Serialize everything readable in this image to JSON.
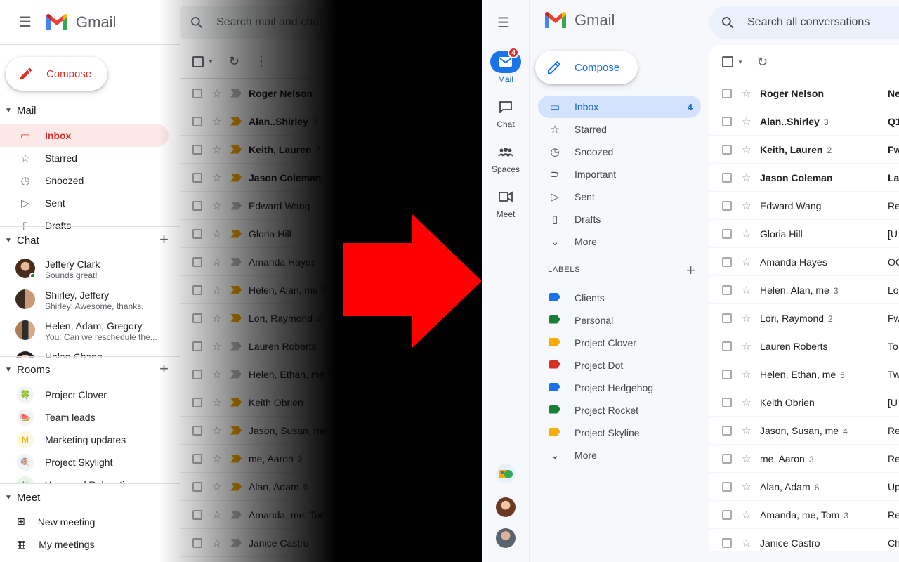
{
  "old": {
    "app_name": "Gmail",
    "compose": "Compose",
    "search_placeholder": "Search mail and chat",
    "mail_header": "Mail",
    "mail_items": [
      {
        "label": "Inbox",
        "icon": "inbox-icon",
        "active": true
      },
      {
        "label": "Starred",
        "icon": "star-icon"
      },
      {
        "label": "Snoozed",
        "icon": "clock-icon"
      },
      {
        "label": "Sent",
        "icon": "send-icon"
      },
      {
        "label": "Drafts",
        "icon": "draft-icon"
      }
    ],
    "chat_header": "Chat",
    "chats": [
      {
        "name": "Jeffery Clark",
        "preview": "Sounds great!"
      },
      {
        "name": "Shirley, Jeffery",
        "preview": "Shirley: Awesome, thanks."
      },
      {
        "name": "Helen, Adam, Gregory",
        "preview": "You: Can we reschedule the..."
      },
      {
        "name": "Helen Chang",
        "preview": ""
      }
    ],
    "rooms_header": "Rooms",
    "rooms": [
      {
        "label": "Project Clover",
        "glyph": "🍀"
      },
      {
        "label": "Team leads",
        "glyph": "🍉"
      },
      {
        "label": "Marketing updates",
        "glyph": "M"
      },
      {
        "label": "Project Skylight",
        "glyph": "🍭"
      },
      {
        "label": "Yoga and Relaxation",
        "glyph": "Y"
      }
    ],
    "meet_header": "Meet",
    "meet_items": [
      {
        "label": "New meeting",
        "icon": "video-plus-icon"
      },
      {
        "label": "My meetings",
        "icon": "calendar-icon"
      }
    ],
    "messages": [
      {
        "sender": "Roger Nelson",
        "count": "",
        "bold": true,
        "important": false
      },
      {
        "sender": "Alan..Shirley",
        "count": "3",
        "bold": true,
        "important": true
      },
      {
        "sender": "Keith, Lauren",
        "count": "2",
        "bold": true,
        "important": true
      },
      {
        "sender": "Jason Coleman",
        "count": "",
        "bold": true,
        "important": true
      },
      {
        "sender": "Edward Wang",
        "count": "",
        "bold": false,
        "important": false
      },
      {
        "sender": "Gloria Hill",
        "count": "",
        "bold": false,
        "important": true
      },
      {
        "sender": "Amanda Hayes",
        "count": "",
        "bold": false,
        "important": false
      },
      {
        "sender": "Helen, Alan, me",
        "count": "3",
        "bold": false,
        "important": true
      },
      {
        "sender": "Lori, Raymond",
        "count": "2",
        "bold": false,
        "important": true
      },
      {
        "sender": "Lauren Roberts",
        "count": "",
        "bold": false,
        "important": false
      },
      {
        "sender": "Helen, Ethan, me",
        "count": "5",
        "bold": false,
        "important": false
      },
      {
        "sender": "Keith Obrien",
        "count": "",
        "bold": false,
        "important": true
      },
      {
        "sender": "Jason, Susan, me",
        "count": "4",
        "bold": false,
        "important": true
      },
      {
        "sender": "me, Aaron",
        "count": "3",
        "bold": false,
        "important": true
      },
      {
        "sender": "Alan, Adam",
        "count": "6",
        "bold": false,
        "important": true
      },
      {
        "sender": "Amanda, me, Tom",
        "count": "3",
        "bold": false,
        "important": false
      },
      {
        "sender": "Janice Castro",
        "count": "",
        "bold": false,
        "important": false
      }
    ]
  },
  "new": {
    "app_name": "Gmail",
    "compose": "Compose",
    "search_placeholder": "Search all conversations",
    "rail": [
      {
        "label": "Mail",
        "icon": "mail-icon",
        "active": true,
        "badge": "4"
      },
      {
        "label": "Chat",
        "icon": "chat-icon"
      },
      {
        "label": "Spaces",
        "icon": "spaces-icon"
      },
      {
        "label": "Meet",
        "icon": "video-icon"
      }
    ],
    "nav": [
      {
        "label": "Inbox",
        "icon": "inbox-icon",
        "active": true,
        "count": "4"
      },
      {
        "label": "Starred",
        "icon": "star-icon"
      },
      {
        "label": "Snoozed",
        "icon": "clock-icon"
      },
      {
        "label": "Important",
        "icon": "important-icon"
      },
      {
        "label": "Sent",
        "icon": "send-icon"
      },
      {
        "label": "Drafts",
        "icon": "draft-icon"
      },
      {
        "label": "More",
        "icon": "chevron-down-icon"
      }
    ],
    "labels_header": "LABELS",
    "labels": [
      {
        "label": "Clients",
        "color": "#1a73e8"
      },
      {
        "label": "Personal",
        "color": "#188038"
      },
      {
        "label": "Project Clover",
        "color": "#f9ab00"
      },
      {
        "label": "Project Dot",
        "color": "#d93025"
      },
      {
        "label": "Project Hedgehog",
        "color": "#1a73e8"
      },
      {
        "label": "Project Rocket",
        "color": "#188038"
      },
      {
        "label": "Project Skyline",
        "color": "#f9ab00"
      }
    ],
    "labels_more": "More",
    "messages": [
      {
        "sender": "Roger Nelson",
        "count": "",
        "bold": true,
        "subject": "Ne"
      },
      {
        "sender": "Alan..Shirley",
        "count": "3",
        "bold": true,
        "subject": "Q1"
      },
      {
        "sender": "Keith, Lauren",
        "count": "2",
        "bold": true,
        "subject": "Fw"
      },
      {
        "sender": "Jason Coleman",
        "count": "",
        "bold": true,
        "subject": "La"
      },
      {
        "sender": "Edward Wang",
        "count": "",
        "bold": false,
        "subject": "Re"
      },
      {
        "sender": "Gloria Hill",
        "count": "",
        "bold": false,
        "subject": "[U"
      },
      {
        "sender": "Amanda Hayes",
        "count": "",
        "bold": false,
        "subject": "OC"
      },
      {
        "sender": "Helen, Alan, me",
        "count": "3",
        "bold": false,
        "subject": "Lo"
      },
      {
        "sender": "Lori, Raymond",
        "count": "2",
        "bold": false,
        "subject": "Fw"
      },
      {
        "sender": "Lauren Roberts",
        "count": "",
        "bold": false,
        "subject": "To"
      },
      {
        "sender": "Helen, Ethan, me",
        "count": "5",
        "bold": false,
        "subject": "Tw"
      },
      {
        "sender": "Keith Obrien",
        "count": "",
        "bold": false,
        "subject": "[U"
      },
      {
        "sender": "Jason, Susan, me",
        "count": "4",
        "bold": false,
        "subject": "Re"
      },
      {
        "sender": "me, Aaron",
        "count": "3",
        "bold": false,
        "subject": "Re"
      },
      {
        "sender": "Alan, Adam",
        "count": "6",
        "bold": false,
        "subject": "Up"
      },
      {
        "sender": "Amanda, me, Tom",
        "count": "3",
        "bold": false,
        "subject": "Re"
      },
      {
        "sender": "Janice Castro",
        "count": "",
        "bold": false,
        "subject": "Ch"
      }
    ]
  },
  "colors": {
    "red": "#d93025",
    "blue": "#1a73e8",
    "yellow": "#f9ab00",
    "green": "#188038",
    "arrow": "#ff0000",
    "new_bg": "#f6f8fc",
    "inbox_active_old": "#fce8e6",
    "inbox_active_new": "#d3e3fd"
  }
}
